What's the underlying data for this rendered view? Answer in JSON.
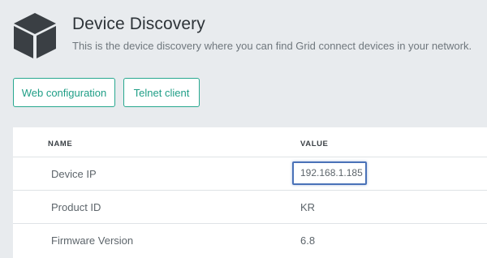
{
  "header": {
    "title": "Device Discovery",
    "subtitle": "This is the device discovery where you can find Grid connect devices in your network.",
    "icon": "cube-icon"
  },
  "actions": {
    "web_configuration_label": "Web configuration",
    "telnet_client_label": "Telnet client"
  },
  "table": {
    "columns": [
      "NAME",
      "VALUE"
    ],
    "rows": [
      {
        "name": "Device IP",
        "value": "192.168.1.185",
        "highlighted": true
      },
      {
        "name": "Product ID",
        "value": "KR"
      },
      {
        "name": "Firmware Version",
        "value": "6.8"
      }
    ]
  },
  "colors": {
    "accent": "#27a88f",
    "highlight": "#4a72b8",
    "background": "#e8ebee"
  }
}
